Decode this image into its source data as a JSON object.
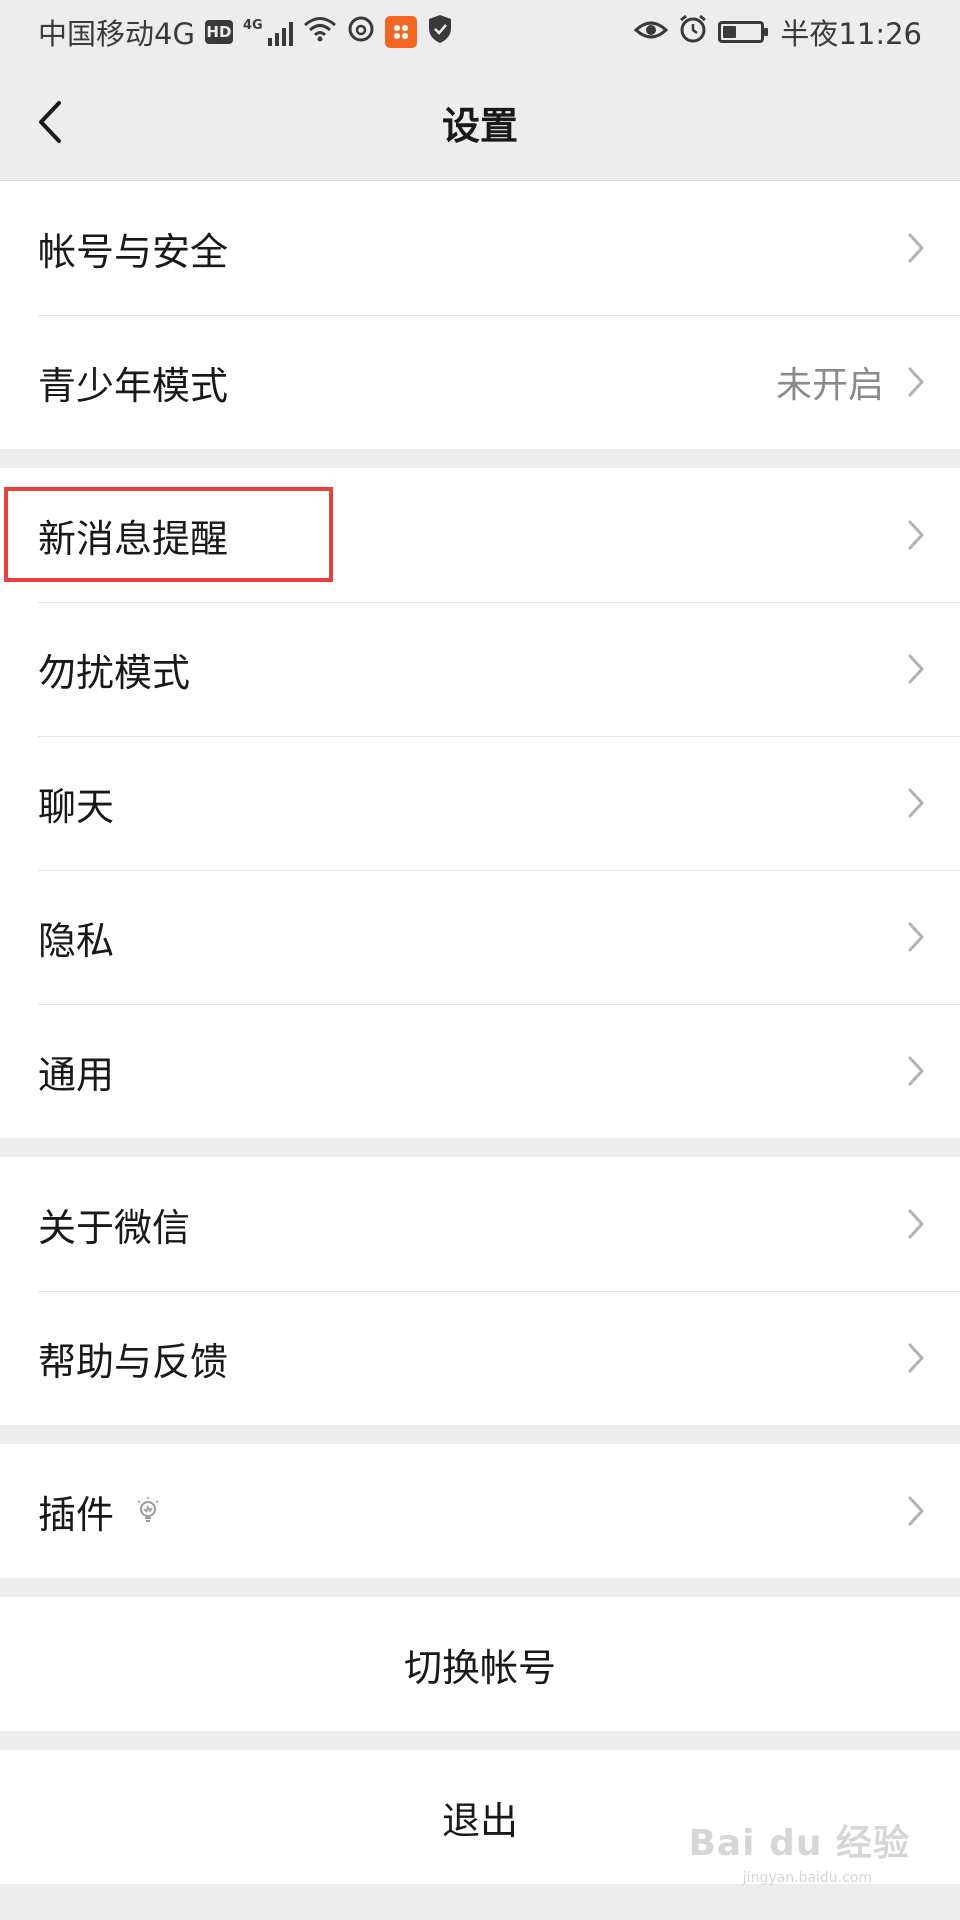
{
  "status_bar": {
    "carrier": "中国移动4G",
    "hd_badge": "HD",
    "network_badge": "4G",
    "time": "半夜11:26",
    "battery_level": 0.35
  },
  "nav": {
    "title": "设置"
  },
  "groups": [
    {
      "items": [
        {
          "label": "帐号与安全",
          "value": ""
        },
        {
          "label": "青少年模式",
          "value": "未开启"
        }
      ]
    },
    {
      "items": [
        {
          "label": "新消息提醒",
          "value": ""
        },
        {
          "label": "勿扰模式",
          "value": ""
        },
        {
          "label": "聊天",
          "value": ""
        },
        {
          "label": "隐私",
          "value": ""
        },
        {
          "label": "通用",
          "value": ""
        }
      ]
    },
    {
      "items": [
        {
          "label": "关于微信",
          "value": ""
        },
        {
          "label": "帮助与反馈",
          "value": ""
        }
      ]
    },
    {
      "items": [
        {
          "label": "插件",
          "value": "",
          "icon": "lightbulb-icon"
        }
      ]
    }
  ],
  "actions": {
    "switch_account": "切换帐号",
    "logout": "退出"
  },
  "watermark": {
    "text": "Bai du 经验",
    "sub": "jingyan.baidu.com"
  },
  "colors": {
    "background": "#ededed",
    "highlight": "#e8403f",
    "chevron": "#b2b2b2"
  }
}
